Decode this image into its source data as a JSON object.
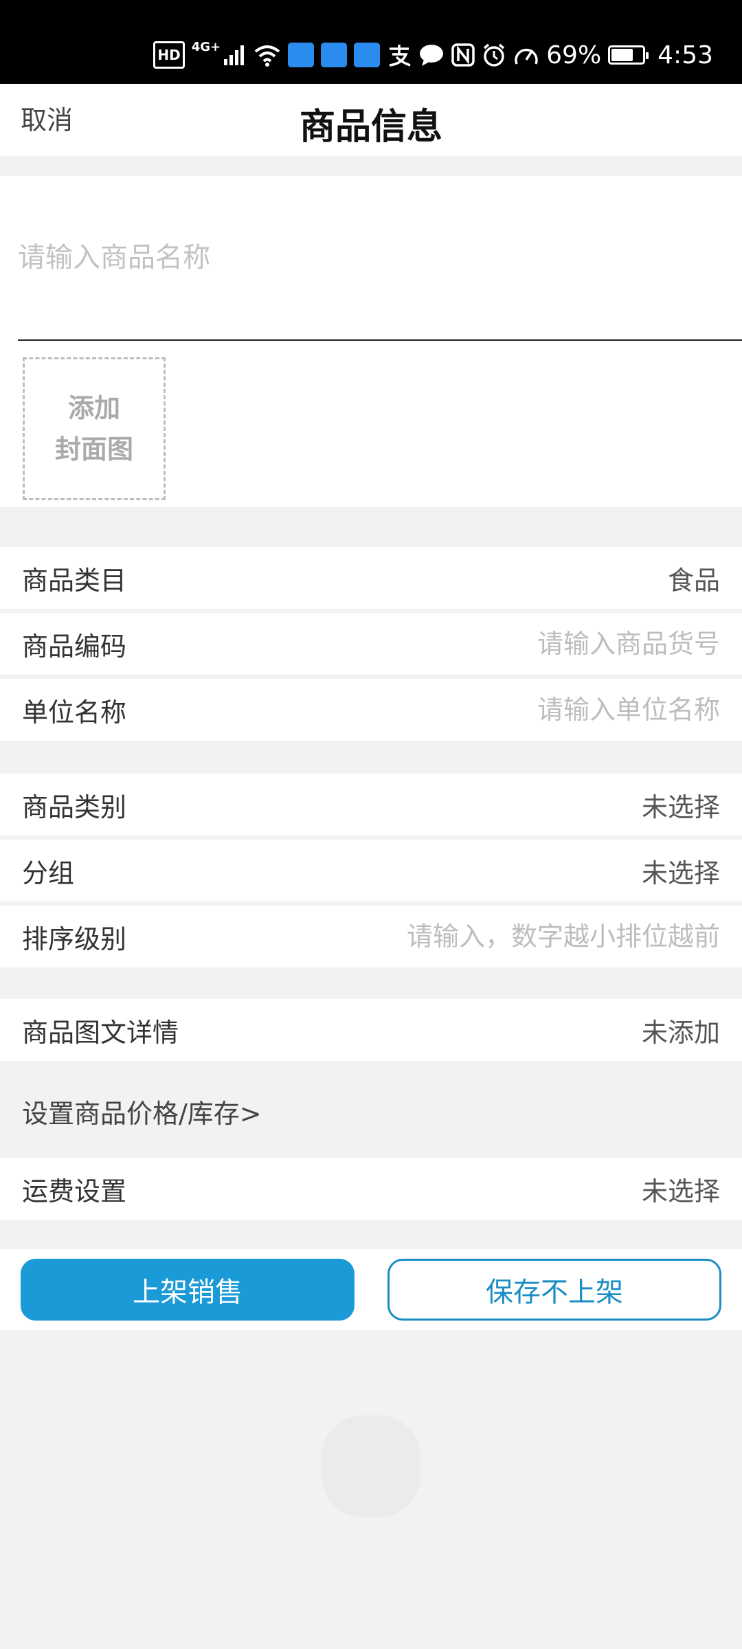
{
  "status_bar": {
    "hd": "HD",
    "network": "4G+",
    "battery_percent": "69%",
    "battery_level": 0.69,
    "time": "4:53",
    "icons": [
      "hd-icon",
      "signal-icon",
      "wifi-icon",
      "app-notification-icon",
      "app-notification-icon",
      "app-notification-icon",
      "alipay-icon",
      "chat-icon",
      "nfc-icon",
      "alarm-icon",
      "speed-icon",
      "battery-icon"
    ]
  },
  "header": {
    "cancel_label": "取消",
    "title": "商品信息"
  },
  "product": {
    "name_placeholder": "请输入商品名称",
    "cover_line1": "添加",
    "cover_line2": "封面图"
  },
  "fields": {
    "category": {
      "label": "商品类目",
      "value": "食品"
    },
    "code": {
      "label": "商品编码",
      "placeholder": "请输入商品货号"
    },
    "unit": {
      "label": "单位名称",
      "placeholder": "请输入单位名称"
    },
    "type": {
      "label": "商品类别",
      "value": "未选择"
    },
    "group": {
      "label": "分组",
      "value": "未选择"
    },
    "sort": {
      "label": "排序级别",
      "placeholder": "请输入，数字越小排位越前"
    },
    "detail": {
      "label": "商品图文详情",
      "value": "未添加"
    },
    "price_link": "设置商品价格/库存>",
    "shipping": {
      "label": "运费设置",
      "value": "未选择"
    }
  },
  "buttons": {
    "publish": "上架销售",
    "save_draft": "保存不上架"
  },
  "colors": {
    "accent": "#1a9ad6",
    "background": "#f2f2f5"
  }
}
